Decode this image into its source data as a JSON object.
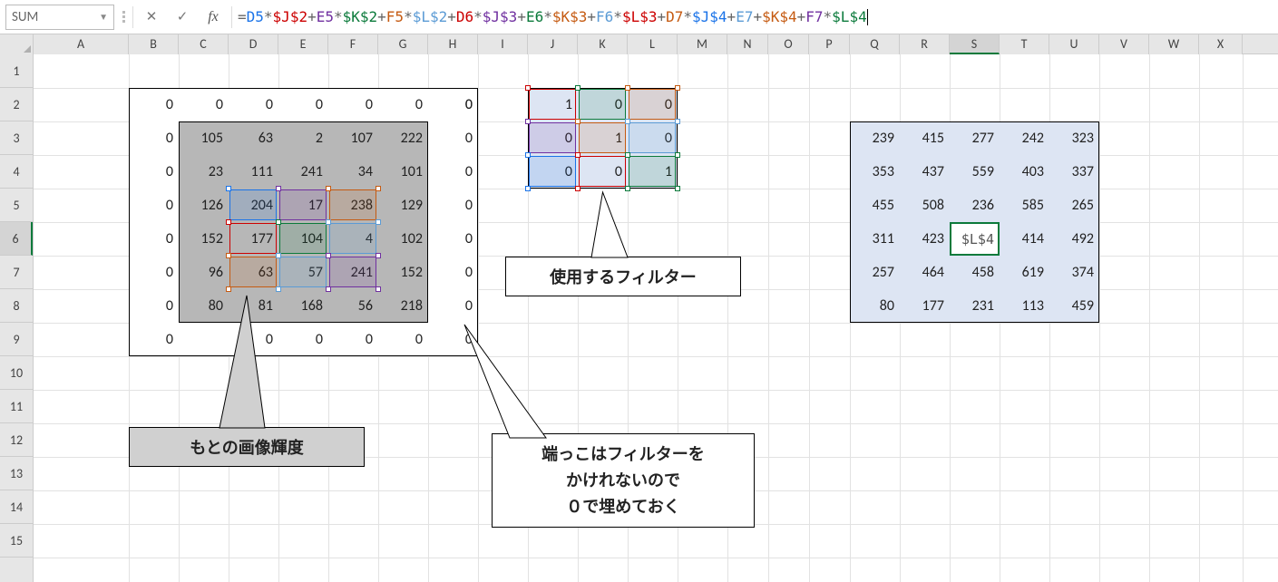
{
  "name_box": "SUM",
  "formula_tokens": [
    {
      "t": "=",
      "cls": "op"
    },
    {
      "t": "D5",
      "cls": "tk-D5"
    },
    {
      "t": "*",
      "cls": "op"
    },
    {
      "t": "$J$2",
      "cls": "tk-J2"
    },
    {
      "t": "+",
      "cls": "op"
    },
    {
      "t": "E5",
      "cls": "tk-E5"
    },
    {
      "t": "*",
      "cls": "op"
    },
    {
      "t": "$K$2",
      "cls": "tk-K2"
    },
    {
      "t": "+",
      "cls": "op"
    },
    {
      "t": "F5",
      "cls": "tk-F5"
    },
    {
      "t": "*",
      "cls": "op"
    },
    {
      "t": "$L$2",
      "cls": "tk-L2"
    },
    {
      "t": "+",
      "cls": "op"
    },
    {
      "t": "D6",
      "cls": "tk-D6"
    },
    {
      "t": "*",
      "cls": "op"
    },
    {
      "t": "$J$3",
      "cls": "tk-J3"
    },
    {
      "t": "+",
      "cls": "op"
    },
    {
      "t": "E6",
      "cls": "tk-E6"
    },
    {
      "t": "*",
      "cls": "op"
    },
    {
      "t": "$K$3",
      "cls": "tk-K3"
    },
    {
      "t": "+",
      "cls": "op"
    },
    {
      "t": "F6",
      "cls": "tk-F6"
    },
    {
      "t": "*",
      "cls": "op"
    },
    {
      "t": "$L$3",
      "cls": "tk-L3"
    },
    {
      "t": "+",
      "cls": "op"
    },
    {
      "t": "D7",
      "cls": "tk-D7"
    },
    {
      "t": "*",
      "cls": "op"
    },
    {
      "t": "$J$4",
      "cls": "tk-J4"
    },
    {
      "t": "+",
      "cls": "op"
    },
    {
      "t": "E7",
      "cls": "tk-E7"
    },
    {
      "t": "+",
      "cls": "op"
    },
    {
      "t": "$K$4",
      "cls": "tk-K4"
    },
    {
      "t": "+",
      "cls": "op"
    },
    {
      "t": "F7",
      "cls": "tk-F7"
    },
    {
      "t": "*",
      "cls": "op"
    },
    {
      "t": "$L$4",
      "cls": "tk-L4"
    }
  ],
  "columns": [
    {
      "l": "A",
      "w": 105
    },
    {
      "l": "B",
      "w": 55
    },
    {
      "l": "C",
      "w": 55
    },
    {
      "l": "D",
      "w": 55
    },
    {
      "l": "E",
      "w": 55
    },
    {
      "l": "F",
      "w": 55
    },
    {
      "l": "G",
      "w": 55
    },
    {
      "l": "H",
      "w": 55
    },
    {
      "l": "I",
      "w": 55
    },
    {
      "l": "J",
      "w": 55
    },
    {
      "l": "K",
      "w": 55
    },
    {
      "l": "L",
      "w": 55
    },
    {
      "l": "M",
      "w": 55
    },
    {
      "l": "N",
      "w": 45
    },
    {
      "l": "O",
      "w": 45
    },
    {
      "l": "P",
      "w": 45
    },
    {
      "l": "Q",
      "w": 55
    },
    {
      "l": "R",
      "w": 55
    },
    {
      "l": "S",
      "w": 55
    },
    {
      "l": "T",
      "w": 55
    },
    {
      "l": "U",
      "w": 55
    },
    {
      "l": "V",
      "w": 55
    },
    {
      "l": "W",
      "w": 55
    },
    {
      "l": "X",
      "w": 48
    }
  ],
  "active_col": "S",
  "active_row": 6,
  "row_count": 15,
  "pad_data": [
    [
      "0",
      "0",
      "0",
      "0",
      "0",
      "0",
      "0",
      "0"
    ],
    [
      "0",
      "105",
      "63",
      "2",
      "107",
      "222",
      "",
      "0"
    ],
    [
      "0",
      "23",
      "111",
      "241",
      "34",
      "101",
      "",
      "0"
    ],
    [
      "0",
      "126",
      "204",
      "17",
      "238",
      "129",
      "",
      "0"
    ],
    [
      "0",
      "152",
      "177",
      "104",
      "4",
      "102",
      "",
      "0"
    ],
    [
      "0",
      "96",
      "63",
      "57",
      "241",
      "152",
      "",
      "0"
    ],
    [
      "0",
      "80",
      "81",
      "168",
      "56",
      "218",
      "",
      "0"
    ],
    [
      "0",
      "",
      "0",
      "0",
      "0",
      "0",
      "",
      "0"
    ]
  ],
  "filter_data": [
    [
      "1",
      "0",
      "0"
    ],
    [
      "0",
      "1",
      "0"
    ],
    [
      "0",
      "0",
      "1"
    ]
  ],
  "result_data": [
    [
      "239",
      "415",
      "277",
      "242",
      "323"
    ],
    [
      "353",
      "437",
      "559",
      "403",
      "337"
    ],
    [
      "455",
      "508",
      "236",
      "585",
      "265"
    ],
    [
      "311",
      "423",
      "$L$4",
      "414",
      "492"
    ],
    [
      "257",
      "464",
      "458",
      "619",
      "374"
    ],
    [
      "80",
      "177",
      "231",
      "113",
      "459"
    ]
  ],
  "edit_cell": {
    "row": 6,
    "col": "S",
    "text": "$L$4"
  },
  "src_highlight": [
    {
      "row": 5,
      "col": "D",
      "color": "#1a73e8"
    },
    {
      "row": 5,
      "col": "E",
      "color": "#7030a0"
    },
    {
      "row": 5,
      "col": "F",
      "color": "#c55a11"
    },
    {
      "row": 6,
      "col": "D",
      "color": "#c00"
    },
    {
      "row": 6,
      "col": "E",
      "color": "#0b7a3b"
    },
    {
      "row": 6,
      "col": "F",
      "color": "#5b9bd5"
    },
    {
      "row": 7,
      "col": "D",
      "color": "#c55a11"
    },
    {
      "row": 7,
      "col": "E",
      "color": "#5b9bd5"
    },
    {
      "row": 7,
      "col": "F",
      "color": "#7030a0"
    }
  ],
  "flt_highlight": [
    {
      "row": 2,
      "col": "J",
      "color": "#c00"
    },
    {
      "row": 2,
      "col": "K",
      "color": "#0b7a3b"
    },
    {
      "row": 2,
      "col": "L",
      "color": "#c55a11"
    },
    {
      "row": 3,
      "col": "J",
      "color": "#7030a0"
    },
    {
      "row": 3,
      "col": "K",
      "color": "#c55a11"
    },
    {
      "row": 3,
      "col": "L",
      "color": "#5b9bd5"
    },
    {
      "row": 4,
      "col": "J",
      "color": "#1a73e8"
    },
    {
      "row": 4,
      "col": "K",
      "color": "#c00"
    },
    {
      "row": 4,
      "col": "L",
      "color": "#0b7a3b"
    }
  ],
  "callouts": {
    "filter": "使用するフィルター",
    "original": "もとの画像輝度",
    "padding": "端っこはフィルターを\nかけれないので\n０で埋めておく"
  }
}
